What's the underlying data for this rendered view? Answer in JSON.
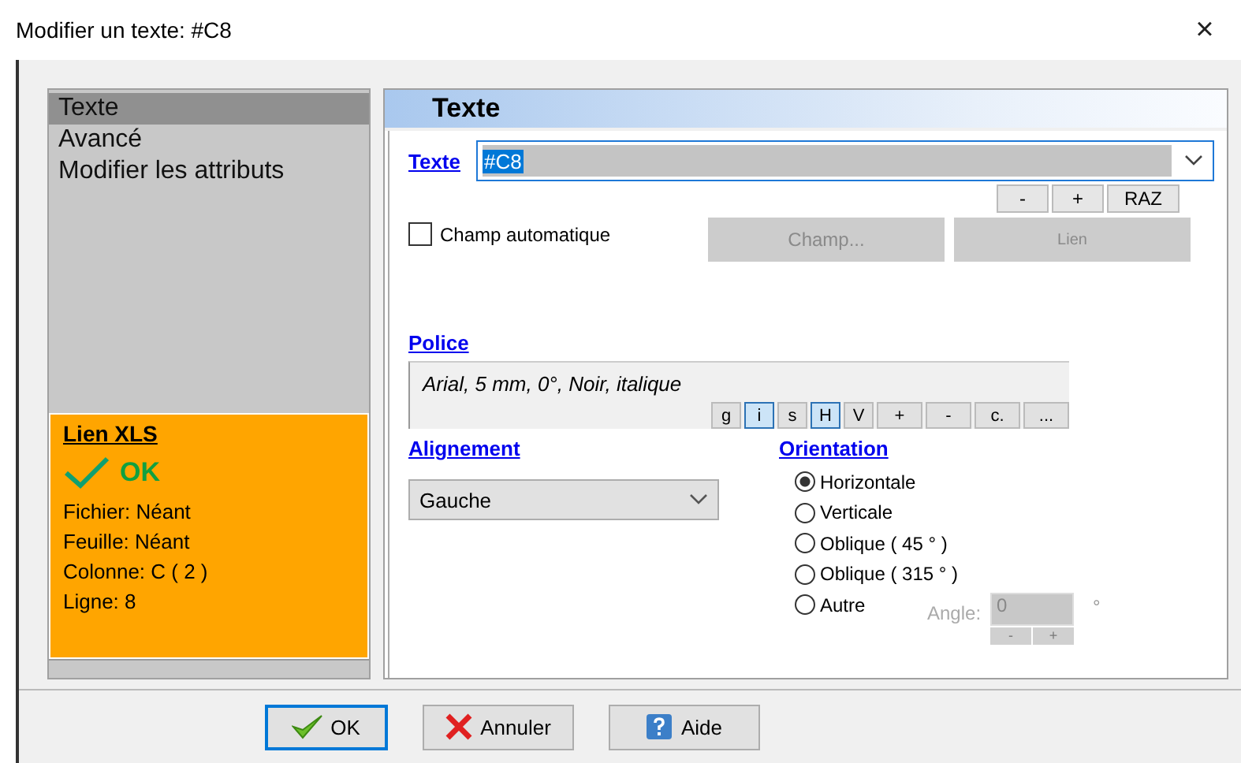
{
  "window": {
    "title": "Modifier un texte: #C8",
    "close": "×"
  },
  "sidebar": {
    "items": [
      {
        "label": "Texte",
        "selected": true
      },
      {
        "label": "Avancé",
        "selected": false
      },
      {
        "label": "Modifier les attributs",
        "selected": false
      }
    ]
  },
  "xls_link": {
    "title": "Lien XLS",
    "status": "OK",
    "lines": [
      "Fichier: Néant",
      "Feuille: Néant",
      "Colonne: C ( 2 )",
      "Ligne: 8"
    ]
  },
  "panel": {
    "title": "Texte",
    "text_field": {
      "label": "Texte",
      "value": "#C8"
    },
    "text_buttons": [
      "-",
      "+",
      "RAZ"
    ],
    "auto_field": {
      "label": "Champ automatique",
      "checked": false
    },
    "field_buttons": [
      {
        "label": "Champ...",
        "disabled": true
      },
      {
        "label": "Lien",
        "disabled": true
      }
    ],
    "font": {
      "label": "Police",
      "description": "Arial, 5 mm, 0°, Noir, italique",
      "buttons": [
        {
          "label": "g",
          "selected": false
        },
        {
          "label": "i",
          "selected": true
        },
        {
          "label": "s",
          "selected": false
        },
        {
          "label": "H",
          "selected": true
        },
        {
          "label": "V",
          "selected": false
        },
        {
          "label": "+",
          "selected": false
        },
        {
          "label": "-",
          "selected": false
        },
        {
          "label": "c.",
          "selected": false
        },
        {
          "label": "...",
          "selected": false
        }
      ]
    },
    "alignment": {
      "label": "Alignement",
      "value": "Gauche"
    },
    "orientation": {
      "label": "Orientation",
      "options": [
        {
          "label": "Horizontale",
          "selected": true
        },
        {
          "label": "Verticale",
          "selected": false
        },
        {
          "label": "Oblique ( 45 ° )",
          "selected": false
        },
        {
          "label": "Oblique ( 315 ° )",
          "selected": false
        },
        {
          "label": "Autre",
          "selected": false
        }
      ],
      "angle": {
        "label": "Angle:",
        "value": "0",
        "unit": "°",
        "disabled": true,
        "buttons": [
          "-",
          "+"
        ]
      }
    }
  },
  "buttons": [
    {
      "kind": "ok",
      "label": "OK"
    },
    {
      "kind": "cancel",
      "label": "Annuler"
    },
    {
      "kind": "help",
      "label": "Aide"
    }
  ]
}
